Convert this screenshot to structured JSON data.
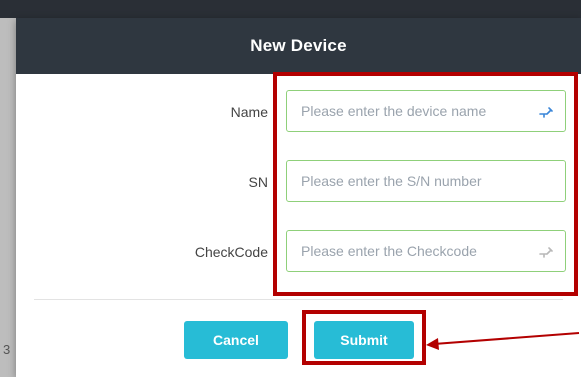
{
  "dialog": {
    "title": "New Device",
    "fields": [
      {
        "label": "Name",
        "placeholder": "Please enter the device name",
        "value": "",
        "icon": "key-icon"
      },
      {
        "label": "SN",
        "placeholder": "Please enter the S/N number",
        "value": ""
      },
      {
        "label": "CheckCode",
        "placeholder": "Please enter the Checkcode",
        "value": "",
        "icon": "key-icon"
      }
    ],
    "buttons": {
      "cancel_label": "Cancel",
      "submit_label": "Submit"
    }
  },
  "background": {
    "edge_char": "3"
  },
  "colors": {
    "header_bg": "#2f3740",
    "button_bg": "#27bcd6",
    "input_border": "#8fd07a",
    "annotation": "#b30000"
  }
}
